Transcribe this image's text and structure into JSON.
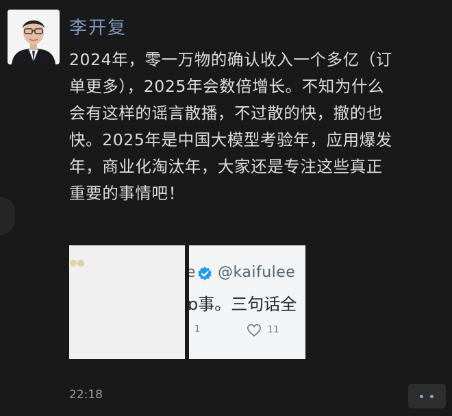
{
  "post": {
    "author": "李开复",
    "lines": [
      "2024年，零一万物的确认收入一个多亿（订",
      "单更多），2025年会数倍增长。不知为什么",
      "会有这样的谣言散播，不过散的快，撤的也",
      "快。2025年是中国大模型考验年，应用爆发",
      "年，商业化淘汰年，大家还是专注这些真正",
      "重要的事情吧！"
    ],
    "time": "22:18"
  },
  "images": {
    "right": {
      "handle_fragment": "e",
      "handle": "@kaifulee",
      "text_fragment": "ɒ事。三句话全",
      "stat_left": "1",
      "likes": "11"
    }
  },
  "colors": {
    "background": "#191919",
    "author_name": "#8397be",
    "body_text": "#dedede",
    "more_dots": "#8fa2c6"
  },
  "icons": [
    "avatar",
    "verified-badge-icon",
    "heart-icon",
    "more-dots-icon"
  ]
}
